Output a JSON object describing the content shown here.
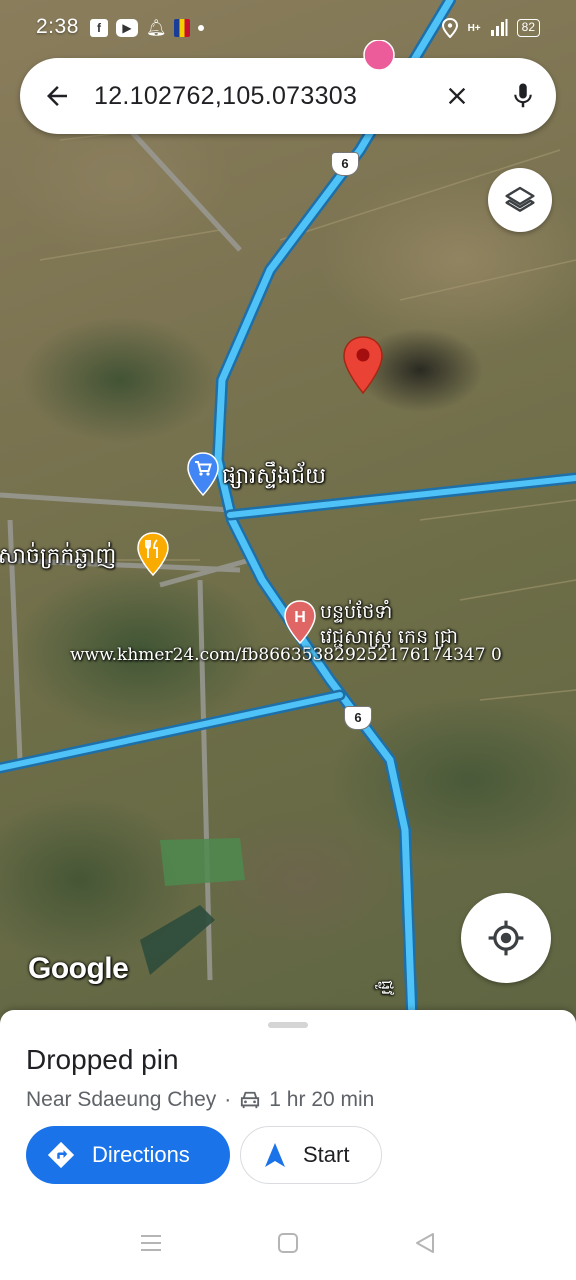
{
  "status_bar": {
    "time": "2:38",
    "icons": [
      "facebook-icon",
      "youtube-icon",
      "notification-bell-icon",
      "flag-icon",
      "dot-icon"
    ],
    "right_icons": [
      "location-icon",
      "signal-icon"
    ],
    "network": "H+",
    "battery": "82"
  },
  "search": {
    "value": "12.102762,105.073303",
    "back_icon": "arrow-back-icon",
    "clear_icon": "close-icon",
    "mic_icon": "mic-icon"
  },
  "map": {
    "route_shields": [
      "6",
      "6"
    ],
    "labels": {
      "market": "ផ្សារស្ទឹងជ័យ",
      "restaurant": "សាច់ក្រក់ឆ្ងាញ់",
      "hospital_line1": "បន្ទប់ថែទាំ",
      "hospital_line2": "វេជ្ជសាស្ត្រ កេន ជ្រា",
      "road_bottom": "ផ្លូវ"
    },
    "watermark": "www.khmer24.com/fb866353829252176174347 0",
    "google_logo": "Google",
    "colors": {
      "road": "#4fc3f7",
      "pin": "#ea4335",
      "poi_shop": "#4285f4",
      "poi_food": "#f9ab00",
      "poi_hospital": "#e06666"
    }
  },
  "sheet": {
    "title": "Dropped pin",
    "subtitle_place": "Near Sdaeung Chey",
    "separator": "·",
    "travel_time": "1 hr 20 min",
    "directions_label": "Directions",
    "start_label": "Start",
    "accent": "#1a73e8"
  },
  "nav_bar": {
    "items": [
      "menu-icon",
      "home-square-icon",
      "back-triangle-icon"
    ]
  }
}
